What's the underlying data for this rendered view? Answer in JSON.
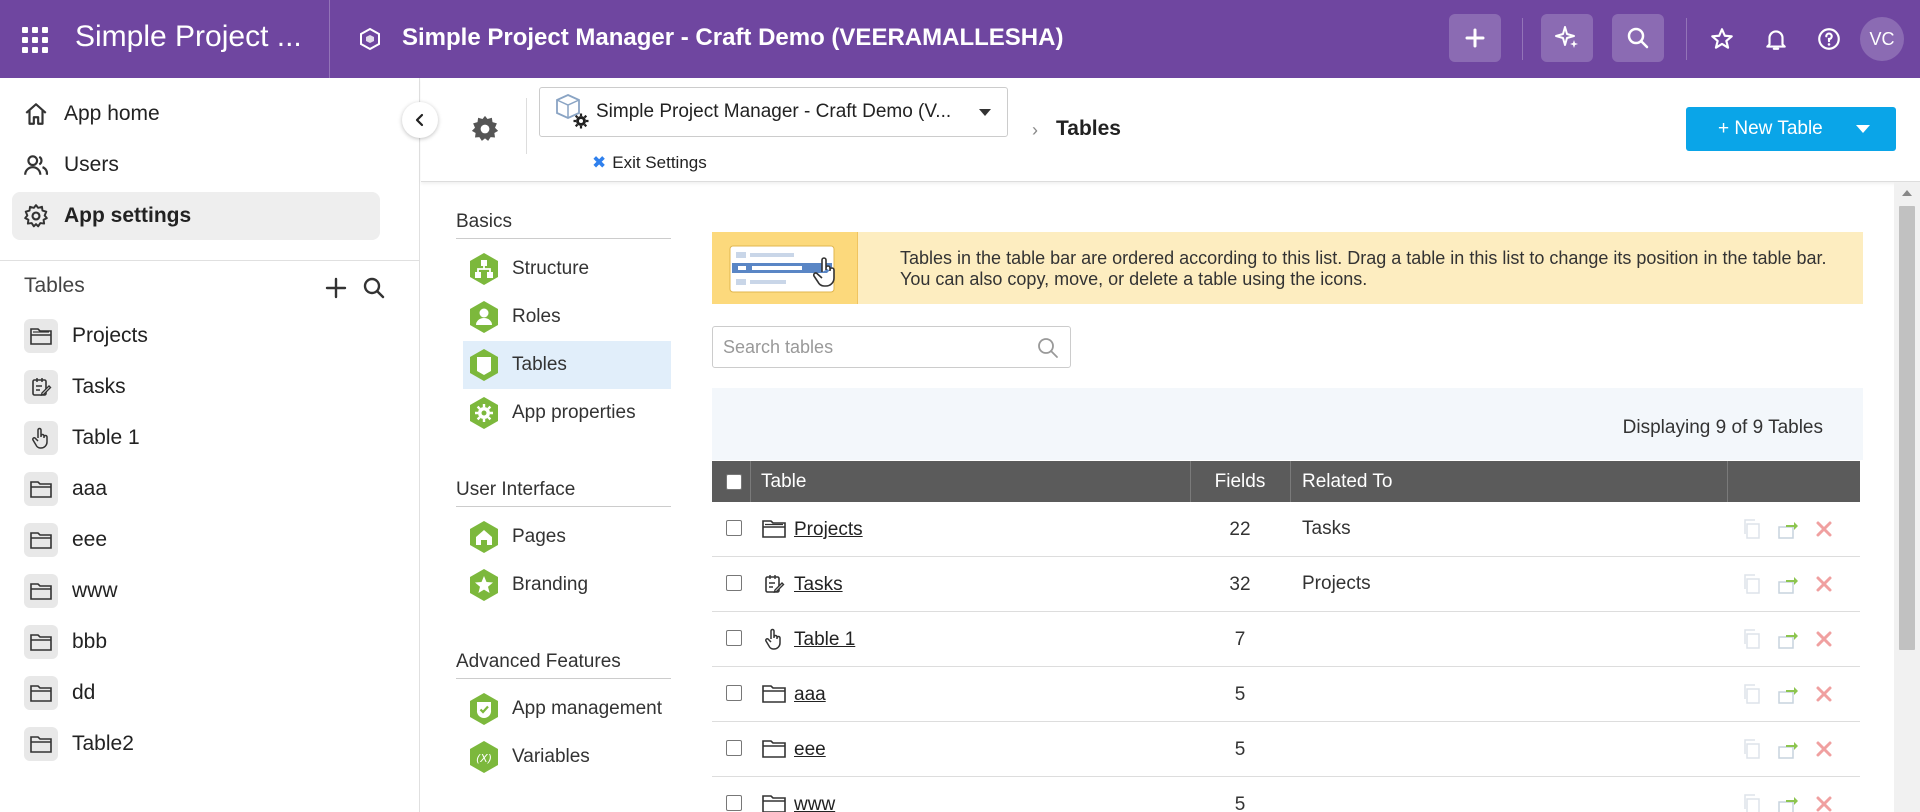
{
  "topbar": {
    "app_name": "Simple Project ...",
    "app_title": "Simple Project Manager - Craft Demo (VEERAMALLESHA)",
    "avatar_initials": "VC",
    "color": "#6f46a0"
  },
  "sidebar": {
    "nav": [
      {
        "label": "App home",
        "icon": "home-icon"
      },
      {
        "label": "Users",
        "icon": "users-icon"
      },
      {
        "label": "App settings",
        "icon": "gear-icon",
        "active": true
      }
    ],
    "tables_heading": "Tables",
    "tables": [
      {
        "label": "Projects",
        "icon": "folder-open-icon"
      },
      {
        "label": "Tasks",
        "icon": "edit-note-icon"
      },
      {
        "label": "Table 1",
        "icon": "hand-pointer-icon"
      },
      {
        "label": "aaa",
        "icon": "folder-icon"
      },
      {
        "label": "eee",
        "icon": "folder-icon"
      },
      {
        "label": "www",
        "icon": "folder-icon"
      },
      {
        "label": "bbb",
        "icon": "folder-icon"
      },
      {
        "label": "dd",
        "icon": "folder-icon"
      },
      {
        "label": "Table2",
        "icon": "folder-icon"
      }
    ]
  },
  "header": {
    "app_select": "Simple Project Manager - Craft Demo (V...",
    "exit_settings": "Exit Settings",
    "breadcrumb_current": "Tables",
    "new_table_button": "+ New Table",
    "button_color": "#0aa5e8"
  },
  "settings_menu": {
    "basics": {
      "heading": "Basics",
      "items": [
        {
          "label": "Structure",
          "icon": "structure-icon"
        },
        {
          "label": "Roles",
          "icon": "user-role-icon"
        },
        {
          "label": "Tables",
          "icon": "table-icon",
          "active": true
        },
        {
          "label": "App properties",
          "icon": "gear-icon"
        }
      ]
    },
    "ui": {
      "heading": "User Interface",
      "items": [
        {
          "label": "Pages",
          "icon": "house-icon"
        },
        {
          "label": "Branding",
          "icon": "star-icon"
        }
      ]
    },
    "advanced": {
      "heading": "Advanced Features",
      "items": [
        {
          "label": "App management",
          "icon": "shield-check-icon"
        },
        {
          "label": "Variables",
          "icon": "variable-icon"
        }
      ]
    }
  },
  "content": {
    "banner_text": "Tables in the table bar are ordered according to this list. Drag a table in this list to change its position in the table bar. You can also copy, move, or delete a table using the icons.",
    "search_placeholder": "Search tables",
    "display_count": "Displaying 9 of 9 Tables",
    "columns": {
      "table": "Table",
      "fields": "Fields",
      "related": "Related To"
    },
    "rows": [
      {
        "name": "Projects",
        "fields": "22",
        "related": "Tasks",
        "icon": "folder-open-icon"
      },
      {
        "name": "Tasks",
        "fields": "32",
        "related": "Projects",
        "icon": "edit-note-icon"
      },
      {
        "name": "Table 1",
        "fields": "7",
        "related": "",
        "icon": "hand-pointer-icon"
      },
      {
        "name": "aaa",
        "fields": "5",
        "related": "",
        "icon": "folder-icon"
      },
      {
        "name": "eee",
        "fields": "5",
        "related": "",
        "icon": "folder-icon"
      },
      {
        "name": "www",
        "fields": "5",
        "related": "",
        "icon": "folder-icon"
      }
    ]
  }
}
